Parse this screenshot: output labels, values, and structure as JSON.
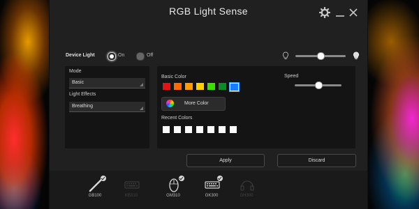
{
  "window": {
    "title": "RGB Light Sense"
  },
  "device_light": {
    "label": "Device Light",
    "on_label": "On",
    "off_label": "Off",
    "state": "on",
    "brightness": 0.5
  },
  "left_panel": {
    "mode_label": "Mode",
    "mode_value": "Basic",
    "effects_label": "Light Effects",
    "effects_value": "Breathing"
  },
  "right_panel": {
    "basic_color_label": "Basic Color",
    "colors": [
      "#e01414",
      "#ff6a00",
      "#ff9a00",
      "#ffd000",
      "#3ce000",
      "#0c8a2a",
      "#1a7cff"
    ],
    "selected_color_index": 6,
    "more_color_label": "More Color",
    "recent_colors_label": "Recent Colors",
    "recent_colors": [
      "#ffffff",
      "#ffffff",
      "#ffffff",
      "#ffffff",
      "#ffffff",
      "#ffffff",
      "#ffffff"
    ],
    "speed_label": "Speed",
    "speed": 0.5
  },
  "actions": {
    "apply_label": "Apply",
    "discard_label": "Discard"
  },
  "devices": [
    {
      "name": "GB100",
      "icon": "pen-icon",
      "active": true,
      "checked": true
    },
    {
      "name": "KB310",
      "icon": "keyboard-icon",
      "active": false,
      "checked": false
    },
    {
      "name": "GM310",
      "icon": "mouse-icon",
      "active": true,
      "checked": true
    },
    {
      "name": "GK300",
      "icon": "keyboard-icon",
      "active": true,
      "checked": true
    },
    {
      "name": "GH300",
      "icon": "headset-icon",
      "active": false,
      "checked": false
    }
  ]
}
